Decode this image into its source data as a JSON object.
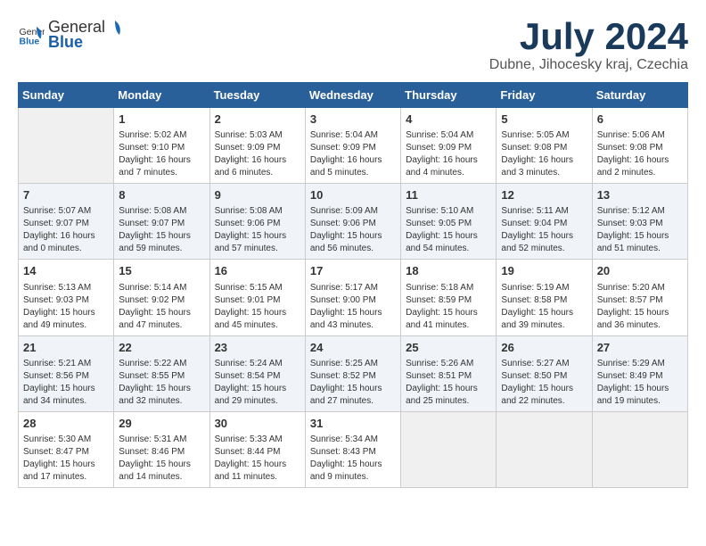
{
  "header": {
    "logo": {
      "general": "General",
      "blue": "Blue"
    },
    "title": "July 2024",
    "location": "Dubne, Jihocesky kraj, Czechia"
  },
  "weekdays": [
    "Sunday",
    "Monday",
    "Tuesday",
    "Wednesday",
    "Thursday",
    "Friday",
    "Saturday"
  ],
  "weeks": [
    [
      {
        "day": "",
        "empty": true
      },
      {
        "day": "1",
        "sunrise": "5:02 AM",
        "sunset": "9:10 PM",
        "daylight": "16 hours and 7 minutes."
      },
      {
        "day": "2",
        "sunrise": "5:03 AM",
        "sunset": "9:09 PM",
        "daylight": "16 hours and 6 minutes."
      },
      {
        "day": "3",
        "sunrise": "5:04 AM",
        "sunset": "9:09 PM",
        "daylight": "16 hours and 5 minutes."
      },
      {
        "day": "4",
        "sunrise": "5:04 AM",
        "sunset": "9:09 PM",
        "daylight": "16 hours and 4 minutes."
      },
      {
        "day": "5",
        "sunrise": "5:05 AM",
        "sunset": "9:08 PM",
        "daylight": "16 hours and 3 minutes."
      },
      {
        "day": "6",
        "sunrise": "5:06 AM",
        "sunset": "9:08 PM",
        "daylight": "16 hours and 2 minutes."
      }
    ],
    [
      {
        "day": "7",
        "sunrise": "5:07 AM",
        "sunset": "9:07 PM",
        "daylight": "16 hours and 0 minutes."
      },
      {
        "day": "8",
        "sunrise": "5:08 AM",
        "sunset": "9:07 PM",
        "daylight": "15 hours and 59 minutes."
      },
      {
        "day": "9",
        "sunrise": "5:08 AM",
        "sunset": "9:06 PM",
        "daylight": "15 hours and 57 minutes."
      },
      {
        "day": "10",
        "sunrise": "5:09 AM",
        "sunset": "9:06 PM",
        "daylight": "15 hours and 56 minutes."
      },
      {
        "day": "11",
        "sunrise": "5:10 AM",
        "sunset": "9:05 PM",
        "daylight": "15 hours and 54 minutes."
      },
      {
        "day": "12",
        "sunrise": "5:11 AM",
        "sunset": "9:04 PM",
        "daylight": "15 hours and 52 minutes."
      },
      {
        "day": "13",
        "sunrise": "5:12 AM",
        "sunset": "9:03 PM",
        "daylight": "15 hours and 51 minutes."
      }
    ],
    [
      {
        "day": "14",
        "sunrise": "5:13 AM",
        "sunset": "9:03 PM",
        "daylight": "15 hours and 49 minutes."
      },
      {
        "day": "15",
        "sunrise": "5:14 AM",
        "sunset": "9:02 PM",
        "daylight": "15 hours and 47 minutes."
      },
      {
        "day": "16",
        "sunrise": "5:15 AM",
        "sunset": "9:01 PM",
        "daylight": "15 hours and 45 minutes."
      },
      {
        "day": "17",
        "sunrise": "5:17 AM",
        "sunset": "9:00 PM",
        "daylight": "15 hours and 43 minutes."
      },
      {
        "day": "18",
        "sunrise": "5:18 AM",
        "sunset": "8:59 PM",
        "daylight": "15 hours and 41 minutes."
      },
      {
        "day": "19",
        "sunrise": "5:19 AM",
        "sunset": "8:58 PM",
        "daylight": "15 hours and 39 minutes."
      },
      {
        "day": "20",
        "sunrise": "5:20 AM",
        "sunset": "8:57 PM",
        "daylight": "15 hours and 36 minutes."
      }
    ],
    [
      {
        "day": "21",
        "sunrise": "5:21 AM",
        "sunset": "8:56 PM",
        "daylight": "15 hours and 34 minutes."
      },
      {
        "day": "22",
        "sunrise": "5:22 AM",
        "sunset": "8:55 PM",
        "daylight": "15 hours and 32 minutes."
      },
      {
        "day": "23",
        "sunrise": "5:24 AM",
        "sunset": "8:54 PM",
        "daylight": "15 hours and 29 minutes."
      },
      {
        "day": "24",
        "sunrise": "5:25 AM",
        "sunset": "8:52 PM",
        "daylight": "15 hours and 27 minutes."
      },
      {
        "day": "25",
        "sunrise": "5:26 AM",
        "sunset": "8:51 PM",
        "daylight": "15 hours and 25 minutes."
      },
      {
        "day": "26",
        "sunrise": "5:27 AM",
        "sunset": "8:50 PM",
        "daylight": "15 hours and 22 minutes."
      },
      {
        "day": "27",
        "sunrise": "5:29 AM",
        "sunset": "8:49 PM",
        "daylight": "15 hours and 19 minutes."
      }
    ],
    [
      {
        "day": "28",
        "sunrise": "5:30 AM",
        "sunset": "8:47 PM",
        "daylight": "15 hours and 17 minutes."
      },
      {
        "day": "29",
        "sunrise": "5:31 AM",
        "sunset": "8:46 PM",
        "daylight": "15 hours and 14 minutes."
      },
      {
        "day": "30",
        "sunrise": "5:33 AM",
        "sunset": "8:44 PM",
        "daylight": "15 hours and 11 minutes."
      },
      {
        "day": "31",
        "sunrise": "5:34 AM",
        "sunset": "8:43 PM",
        "daylight": "15 hours and 9 minutes."
      },
      {
        "day": "",
        "empty": true
      },
      {
        "day": "",
        "empty": true
      },
      {
        "day": "",
        "empty": true
      }
    ]
  ]
}
